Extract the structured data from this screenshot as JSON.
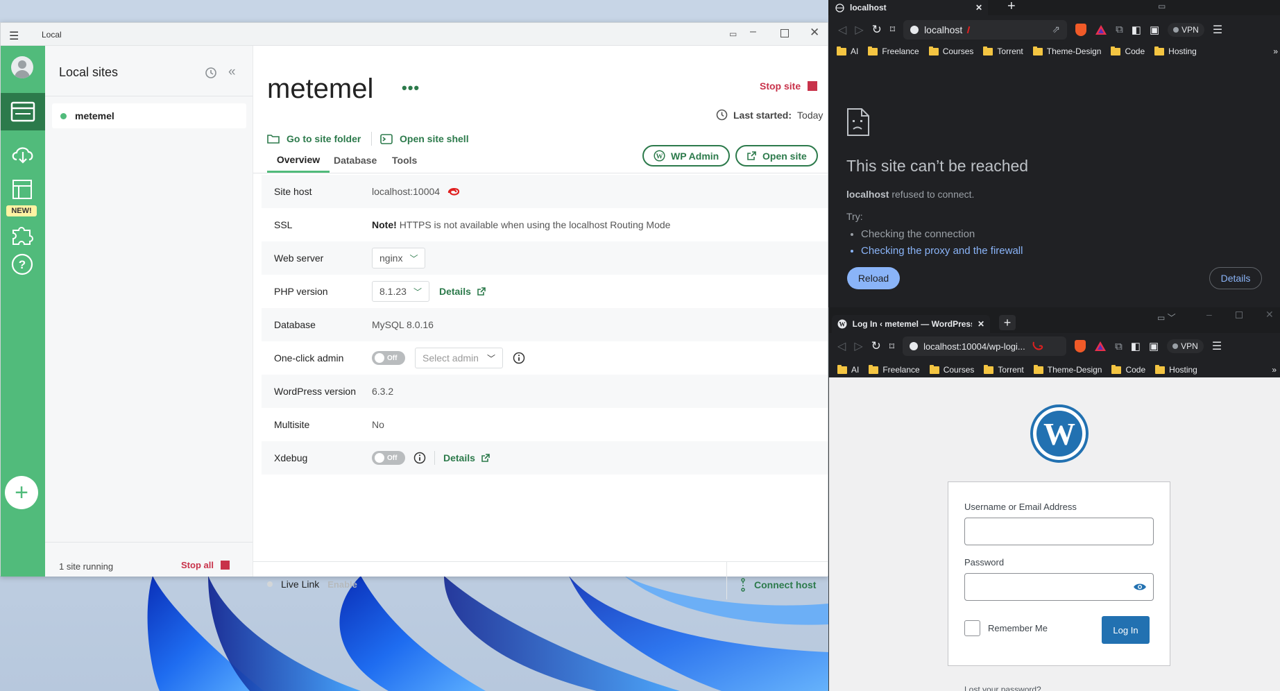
{
  "local": {
    "window_title": "Local",
    "new_badge": "NEW!",
    "sidebar": {
      "title": "Local sites",
      "site_name": "metemel",
      "footer_status": "1 site running",
      "stop_all": "Stop all"
    },
    "header": {
      "site_title": "metemel",
      "stop_site": "Stop site",
      "last_started_label": "Last started:",
      "last_started_value": "Today",
      "go_to_folder": "Go to site folder",
      "open_shell": "Open site shell"
    },
    "tabs": [
      "Overview",
      "Database",
      "Tools"
    ],
    "wp_admin": "WP Admin",
    "open_site": "Open site",
    "rows": {
      "site_host": {
        "label": "Site host",
        "value": "localhost:10004"
      },
      "ssl": {
        "label": "SSL",
        "note": "Note!",
        "value": "HTTPS is not available when using the localhost Routing Mode"
      },
      "web_server": {
        "label": "Web server",
        "value": "nginx"
      },
      "php": {
        "label": "PHP version",
        "value": "8.1.23",
        "details": "Details"
      },
      "database": {
        "label": "Database",
        "value": "MySQL 8.0.16"
      },
      "one_click": {
        "label": "One-click admin",
        "toggle": "Off",
        "placeholder": "Select admin"
      },
      "wp_version": {
        "label": "WordPress version",
        "value": "6.3.2"
      },
      "multisite": {
        "label": "Multisite",
        "value": "No"
      },
      "xdebug": {
        "label": "Xdebug",
        "toggle": "Off",
        "details": "Details"
      }
    },
    "footer": {
      "live_link": "Live Link",
      "enable": "Enable",
      "connect_host": "Connect host"
    }
  },
  "browser_top": {
    "tab_title": "localhost",
    "url": "localhost",
    "vpn": "VPN",
    "bookmarks": [
      "AI",
      "Freelance",
      "Courses",
      "Torrent",
      "Theme-Design",
      "Code",
      "Hosting"
    ],
    "error_title": "This site can’t be reached",
    "error_host": "localhost",
    "error_msg": "refused to connect.",
    "try_label": "Try:",
    "suggestion_1": "Checking the connection",
    "suggestion_2": "Checking the proxy and the firewall",
    "reload": "Reload",
    "details": "Details"
  },
  "browser_bottom": {
    "tab_title": "Log In ‹ metemel — WordPress",
    "url": "localhost:10004/wp-logi...",
    "vpn": "VPN",
    "bookmarks": [
      "AI",
      "Freelance",
      "Courses",
      "Torrent",
      "Theme-Design",
      "Code",
      "Hosting"
    ],
    "username_label": "Username or Email Address",
    "password_label": "Password",
    "remember_me": "Remember Me",
    "login_button": "Log In",
    "lost_password": "Lost your password?"
  },
  "colors": {
    "local_green": "#51bb7b",
    "local_dark_green": "#2c7a4b",
    "stop_red": "#c8324a",
    "wp_blue": "#2271b1",
    "chrome_dark": "#202124",
    "link_blue": "#8ab4f8"
  }
}
